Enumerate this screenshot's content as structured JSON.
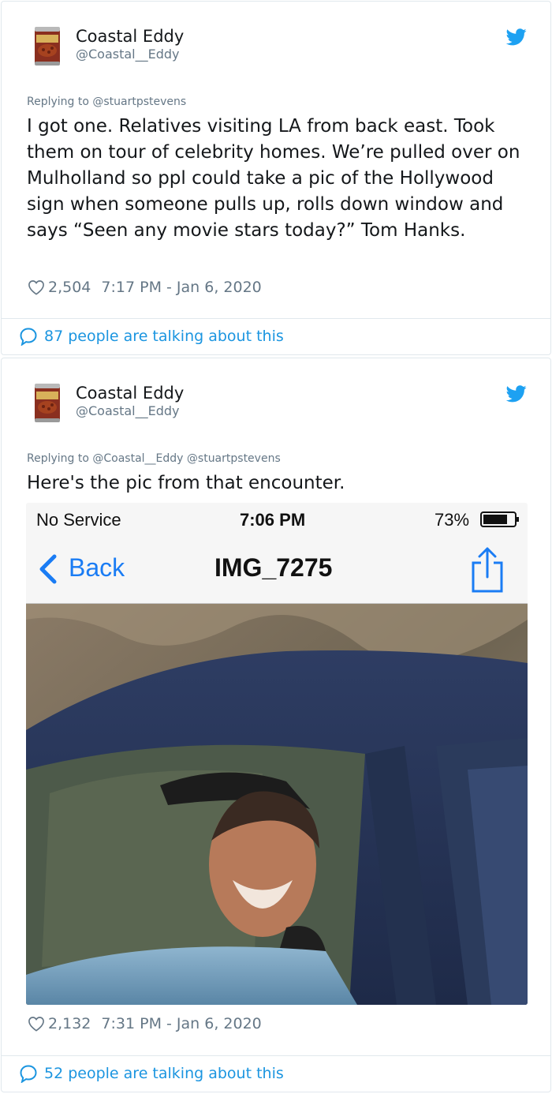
{
  "tweets": [
    {
      "name": "Coastal Eddy",
      "handle": "@Coastal__Eddy",
      "replying_to": "Replying to @stuartpstevens",
      "text": "I got one. Relatives visiting LA from back east. Took them on tour of celebrity homes. We’re pulled over on Mulholland so ppl could take a pic of the Hollywood sign when someone pulls up, rolls down window and says “Seen any movie stars today?” Tom Hanks.",
      "likes": "2,504",
      "timestamp": "7:17 PM - Jan 6, 2020",
      "talking": "87 people are talking about this"
    },
    {
      "name": "Coastal Eddy",
      "handle": "@Coastal__Eddy",
      "replying_to": "Replying to @Coastal__Eddy @stuartpstevens",
      "text": "Here's the pic from that encounter.",
      "likes": "2,132",
      "timestamp": "7:31 PM - Jan 6, 2020",
      "talking": "52 people are talking about this",
      "screenshot": {
        "carrier": "No Service",
        "time": "7:06 PM",
        "battery": "73%",
        "back_label": "Back",
        "title": "IMG_7275"
      }
    }
  ],
  "colors": {
    "link": "#1b95e0",
    "secondary": "#657786",
    "ios_blue": "#1a7cf4"
  },
  "icons": {
    "avatar": "beans-can-avatar",
    "brand": "twitter-bird-icon",
    "like": "heart-outline-icon",
    "talk": "speech-bubble-icon",
    "share": "ios-share-icon"
  }
}
